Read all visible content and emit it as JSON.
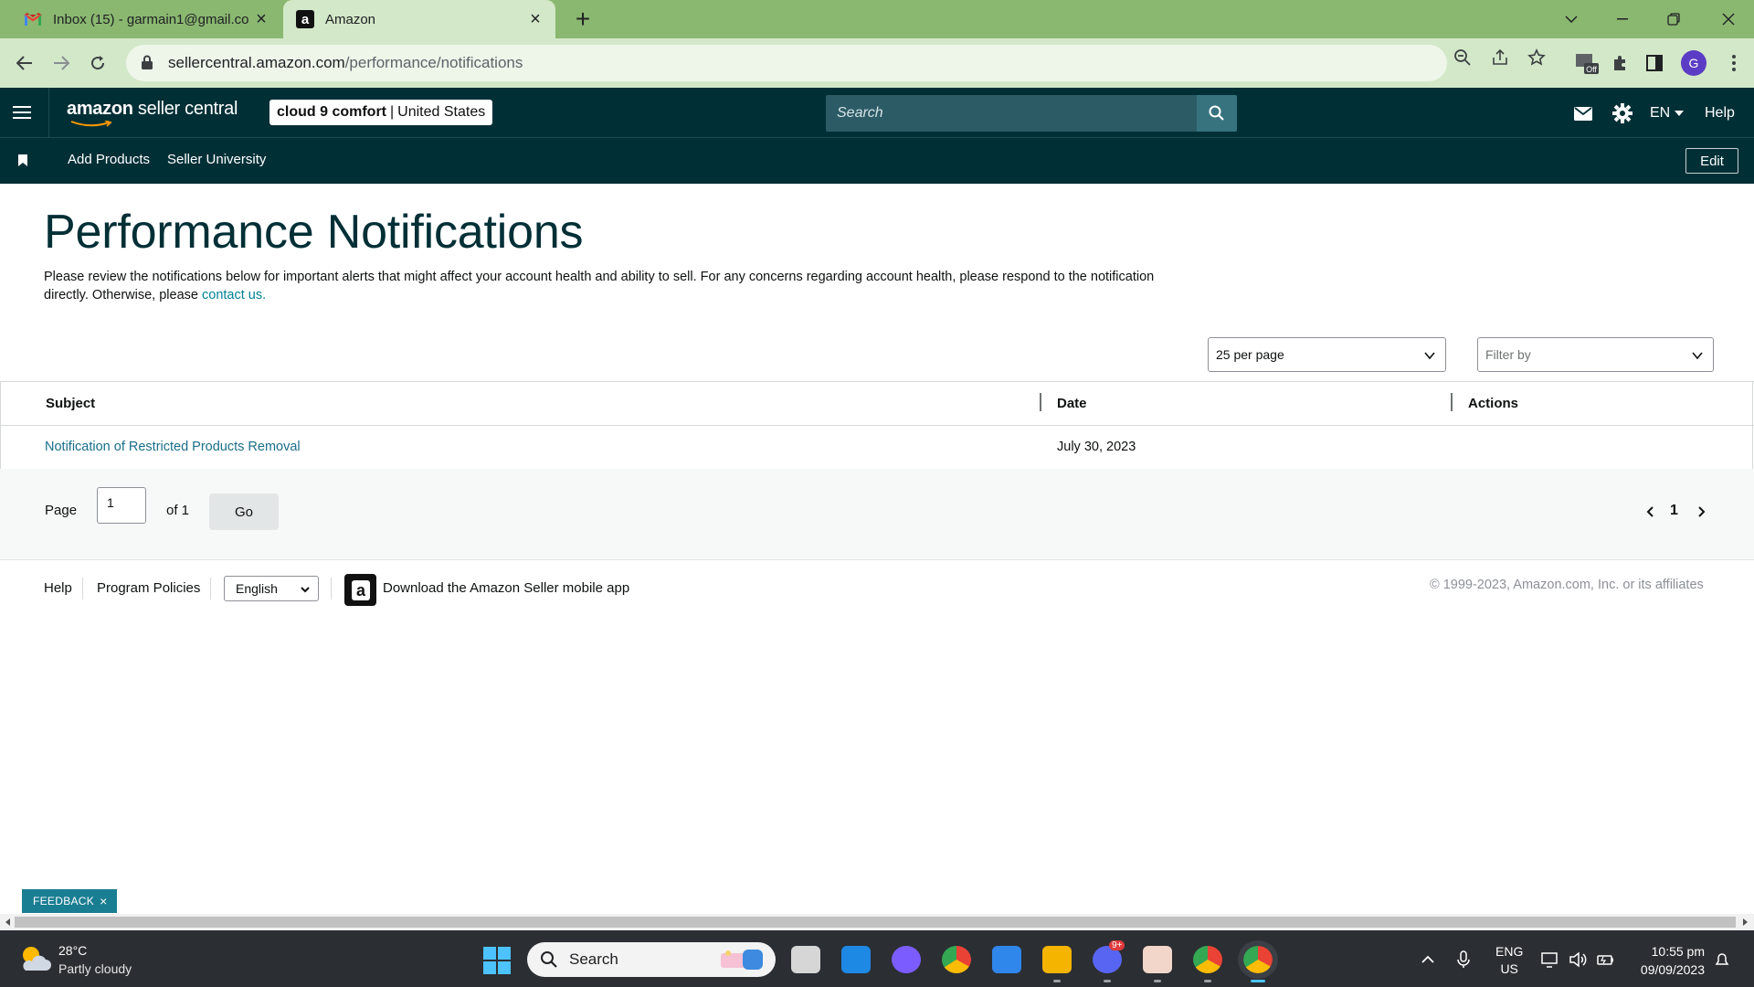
{
  "browser": {
    "tabs": [
      {
        "title": "Inbox (15) - garmain1@gmail.com",
        "icon": "gmail-icon",
        "active": false
      },
      {
        "title": "Amazon",
        "icon": "amazon-icon",
        "active": true
      }
    ],
    "url_domain": "sellercentral.amazon.com",
    "url_path": "/performance/notifications",
    "extension_badge": "Off",
    "profile_initial": "G"
  },
  "header": {
    "logo_brand": "amazon",
    "logo_suffix": " seller central",
    "account_name": "cloud 9 comfort",
    "account_sep": "|",
    "account_region": "United States",
    "search_placeholder": "Search",
    "language": "EN",
    "help": "Help"
  },
  "subnav": {
    "links": [
      "Add Products",
      "Seller University"
    ],
    "edit_label": "Edit"
  },
  "page": {
    "title": "Performance Notifications",
    "intro_text": "Please review the notifications below for important alerts that might affect your account health and ability to sell. For any concerns regarding account health, please respond to the notification directly. Otherwise, please ",
    "intro_link": "contact us.",
    "per_page": "25 per page",
    "filter_placeholder": "Filter by"
  },
  "table": {
    "columns": [
      "Subject",
      "Date",
      "Actions"
    ],
    "rows": [
      {
        "subject": "Notification of Restricted Products Removal",
        "date": "July 30, 2023",
        "actions": ""
      }
    ]
  },
  "pager": {
    "page_label": "Page",
    "current_page": "1",
    "of_label": "of 1",
    "go_label": "Go",
    "page_number": "1"
  },
  "footer": {
    "help": "Help",
    "program_policies": "Program Policies",
    "language": "English",
    "app_text": "Download the Amazon Seller mobile app",
    "copyright": "© 1999-2023, Amazon.com, Inc. or its affiliates"
  },
  "feedback": {
    "label": "FEEDBACK",
    "close": "×"
  },
  "taskbar": {
    "temperature": "28°C",
    "condition": "Partly cloudy",
    "search_label": "Search",
    "discord_badge": "9+",
    "input_lang": "ENG",
    "input_region": "US",
    "time": "10:55 pm",
    "date": "09/09/2023"
  },
  "colors": {
    "header_bg": "#002f36",
    "tabstrip_bg": "#8ab870",
    "link": "#008296",
    "title": "#002f36"
  }
}
